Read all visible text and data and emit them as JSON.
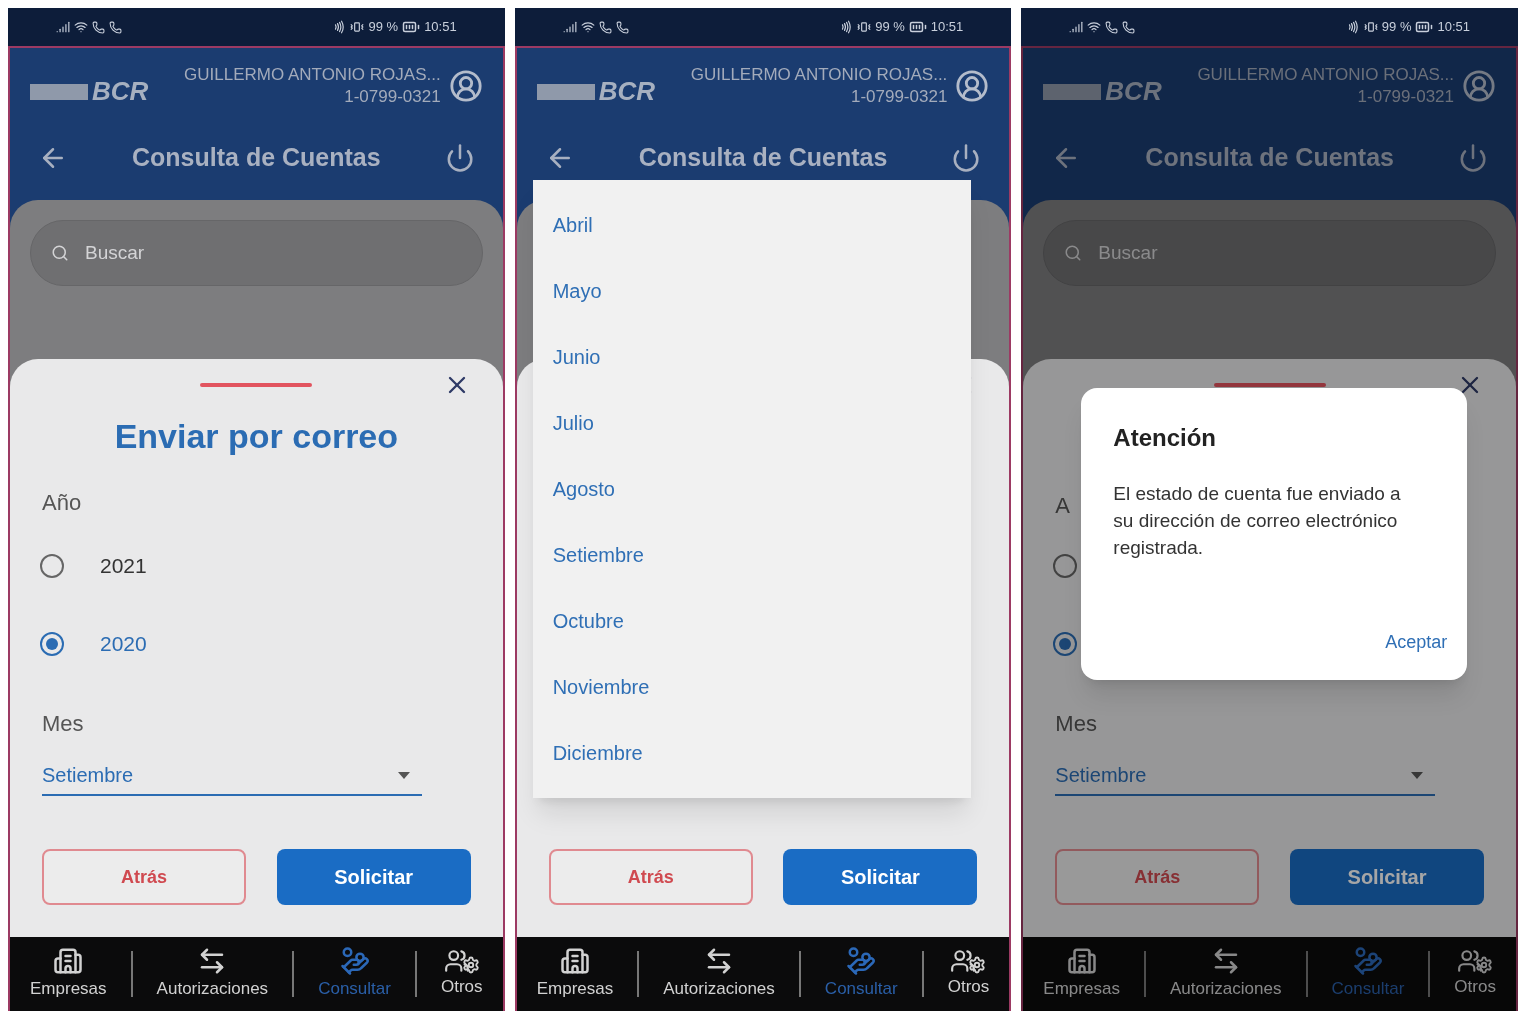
{
  "phones": [
    {
      "status_bar": {
        "battery": "99 %",
        "time": "10:51"
      },
      "header": {
        "logo_text": "BCR",
        "user_name": "GUILLERMO ANTONIO ROJAS...",
        "user_id": "1-0799-0321",
        "title": "Consulta de Cuentas"
      },
      "search": {
        "placeholder": "Buscar"
      },
      "sheet": {
        "title": "Enviar por correo",
        "year_label": "Año",
        "years": [
          {
            "label": "2021",
            "selected": false
          },
          {
            "label": "2020",
            "selected": true
          }
        ],
        "month_label": "Mes",
        "month_value": "Setiembre",
        "buttons": [
          {
            "label": "Atrás",
            "kind": "outline"
          },
          {
            "label": "Solicitar",
            "kind": "primary"
          }
        ]
      },
      "nav": [
        {
          "label": "Empresas",
          "kind": "building",
          "selected": false
        },
        {
          "label": "Autorizaciones",
          "kind": "arrows",
          "selected": false
        },
        {
          "label": "Consultar",
          "kind": "hand",
          "selected": true
        },
        {
          "label": "Otros",
          "kind": "people",
          "selected": false
        }
      ]
    },
    {
      "status_bar": {
        "battery": "99 %",
        "time": "10:51"
      },
      "header": {
        "logo_text": "BCR",
        "user_name": "GUILLERMO ANTONIO ROJAS...",
        "user_id": "1-0799-0321",
        "title": "Consulta de Cuentas"
      },
      "sheet": {
        "buttons": [
          {
            "label": "Atrás",
            "kind": "outline"
          },
          {
            "label": "Solicitar",
            "kind": "primary"
          }
        ]
      },
      "overlay": {
        "kind": "dropdown",
        "items": [
          "Abril",
          "Mayo",
          "Junio",
          "Julio",
          "Agosto",
          "Setiembre",
          "Octubre",
          "Noviembre",
          "Diciembre"
        ]
      },
      "nav": [
        {
          "label": "Empresas",
          "kind": "building",
          "selected": false
        },
        {
          "label": "Autorizaciones",
          "kind": "arrows",
          "selected": false
        },
        {
          "label": "Consultar",
          "kind": "hand",
          "selected": true
        },
        {
          "label": "Otros",
          "kind": "people",
          "selected": false
        }
      ]
    },
    {
      "status_bar": {
        "battery": "99 %",
        "time": "10:51"
      },
      "header": {
        "logo_text": "BCR",
        "user_name": "GUILLERMO ANTONIO ROJAS...",
        "user_id": "1-0799-0321",
        "title": "Consulta de Cuentas"
      },
      "search": {
        "placeholder": "Buscar"
      },
      "sheet": {
        "year_label": "A",
        "years": [
          {
            "selected": false
          },
          {
            "selected": true
          }
        ],
        "month_label": "Mes",
        "month_value": "Setiembre",
        "buttons": [
          {
            "label": "Atrás",
            "kind": "outline"
          },
          {
            "label": "Solicitar",
            "kind": "primary"
          }
        ]
      },
      "overlay": {
        "kind": "dialog",
        "title": "Atención",
        "message": "El estado de cuenta fue enviado a su dirección de correo electrónico registrada.",
        "action": "Aceptar"
      },
      "nav": [
        {
          "label": "Empresas",
          "kind": "building",
          "selected": false
        },
        {
          "label": "Autorizaciones",
          "kind": "arrows",
          "selected": false
        },
        {
          "label": "Consultar",
          "kind": "hand",
          "selected": true
        },
        {
          "label": "Otros",
          "kind": "people",
          "selected": false
        }
      ]
    }
  ]
}
